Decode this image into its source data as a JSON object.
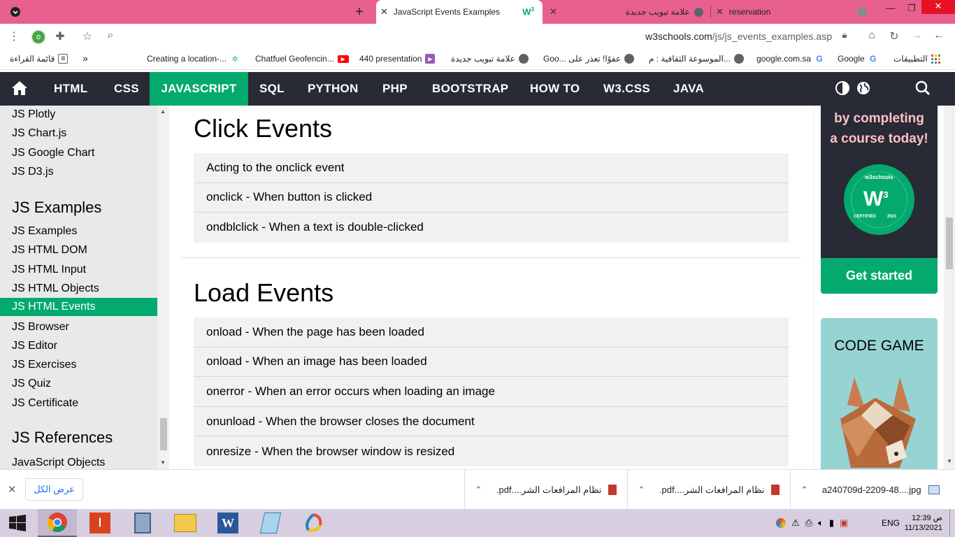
{
  "browser": {
    "tabs": [
      {
        "title": "JavaScript Events Examples",
        "active": true
      },
      {
        "title": "علامة تبويب جديدة",
        "active": false
      },
      {
        "title": "reservation",
        "active": false
      }
    ],
    "url_domain": "w3schools.com",
    "url_path": "/js/js_events_examples.asp",
    "profile_initial": "o",
    "bookmarks": [
      {
        "label": "قائمة القراءة",
        "icon": "reading-list-icon"
      },
      {
        "label": "Creating a location-...",
        "icon": "site-icon"
      },
      {
        "label": "Chatfuel Geofencin...",
        "icon": "youtube-icon"
      },
      {
        "label": "440 presentation",
        "icon": "slides-icon"
      },
      {
        "label": "علامة تبويب جديدة",
        "icon": "globe-icon"
      },
      {
        "label": "Goo... عفوًا! تعذر على",
        "icon": "globe-icon"
      },
      {
        "label": "الموسوعة الثقافية : م...",
        "icon": "globe-icon"
      },
      {
        "label": "google.com.sa",
        "icon": "google-icon"
      },
      {
        "label": "Google",
        "icon": "google-icon"
      },
      {
        "label": "التطبيقات",
        "icon": "apps-icon"
      }
    ],
    "overflow": "»"
  },
  "nav": {
    "items": [
      "HTML",
      "CSS",
      "JAVASCRIPT",
      "SQL",
      "PYTHON",
      "PHP",
      "BOOTSTRAP",
      "HOW TO",
      "W3.CSS",
      "JAVA"
    ],
    "active": "JAVASCRIPT"
  },
  "sidebar": {
    "top_items": [
      "JS Plotly",
      "JS Chart.js",
      "JS Google Chart",
      "JS D3.js"
    ],
    "examples_heading": "JS Examples",
    "examples_items": [
      "JS Examples",
      "JS HTML DOM",
      "JS HTML Input",
      "JS HTML Objects",
      "JS HTML Events",
      "JS Browser",
      "JS Editor",
      "JS Exercises",
      "JS Quiz",
      "JS Certificate"
    ],
    "active_item": "JS HTML Events",
    "references_heading": "JS References",
    "references_items": [
      "JavaScript Objects"
    ]
  },
  "main": {
    "click_title": "Click Events",
    "click_items": [
      "Acting to the onclick event",
      "onclick - When button is clicked",
      "ondblclick - When a text is double-clicked"
    ],
    "load_title": "Load Events",
    "load_items": [
      "onload - When the page has been loaded",
      "onload - When an image has been loaded",
      "onerror - When an error occurs when loading an image",
      "onunload - When the browser closes the document",
      "onresize - When the browser window is resized"
    ]
  },
  "ads": {
    "cert_line1": "by completing",
    "cert_line2": "a course today!",
    "badge_brand": "w3schools",
    "badge_mark": "W",
    "badge_sup": "3",
    "badge_cert": "CERTIFIED",
    "badge_year": "2021",
    "cta": "Get started",
    "game_title": "CODE GAME"
  },
  "downloads": {
    "show_all": "عرض الكل",
    "items": [
      {
        "name": ".pdf....نظام المرافعات الشر",
        "type": "pdf"
      },
      {
        "name": ".pdf....نظام المرافعات الشر",
        "type": "pdf"
      },
      {
        "name": "a240709d-2209-48....jpg",
        "type": "image"
      }
    ]
  },
  "taskbar": {
    "lang": "ENG",
    "time": "12:39 ص",
    "date": "11/13/2021"
  }
}
